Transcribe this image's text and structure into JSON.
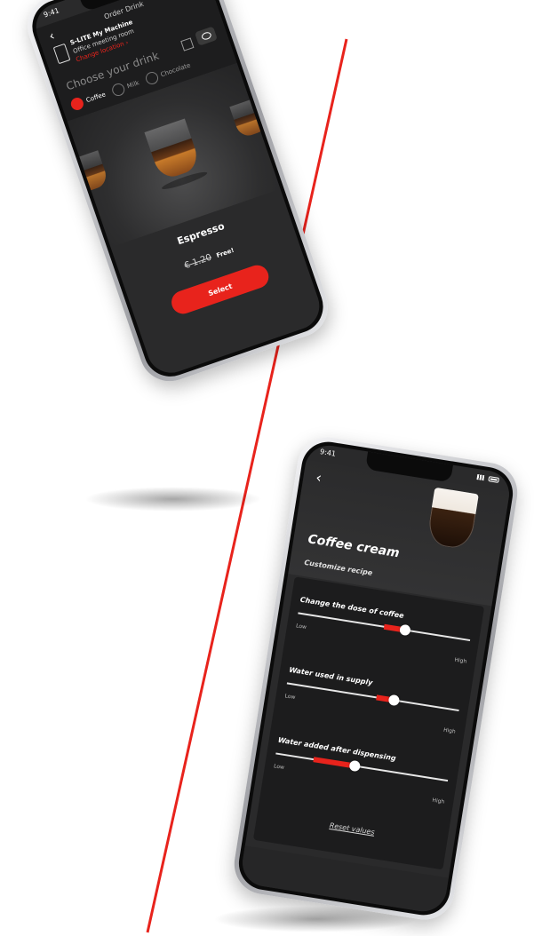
{
  "colors": {
    "accent": "#e8231c",
    "screen_bg": "#2a2a2b",
    "panel_bg": "#1c1c1d"
  },
  "phone1": {
    "status": {
      "time": "9:41"
    },
    "header": {
      "title": "Order Drink"
    },
    "machine": {
      "name": "S-LITE My Machine",
      "location": "Office meeting room",
      "change_link": "Change location ›"
    },
    "choose_label": "Choose your drink",
    "tabs": [
      {
        "label": "Coffee",
        "active": true
      },
      {
        "label": "Milk",
        "active": false
      },
      {
        "label": "Chocolate",
        "active": false
      }
    ],
    "drink": {
      "name": "Espresso",
      "old_price": "€ 1.20",
      "free_label": "Free!"
    },
    "select_button": "Select"
  },
  "phone2": {
    "status": {
      "time": "9:41"
    },
    "title": "Coffee cream",
    "subtitle": "Customize recipe",
    "sliders": [
      {
        "label": "Change the dose of coffee",
        "low": "Low",
        "high": "High",
        "fill_start": 0.5,
        "value": 0.62
      },
      {
        "label": "Water used in supply",
        "low": "Low",
        "high": "High",
        "fill_start": 0.52,
        "value": 0.62
      },
      {
        "label": "Water added after dispensing",
        "low": "Low",
        "high": "High",
        "fill_start": 0.22,
        "value": 0.46
      }
    ],
    "reset_label": "Reset values"
  }
}
